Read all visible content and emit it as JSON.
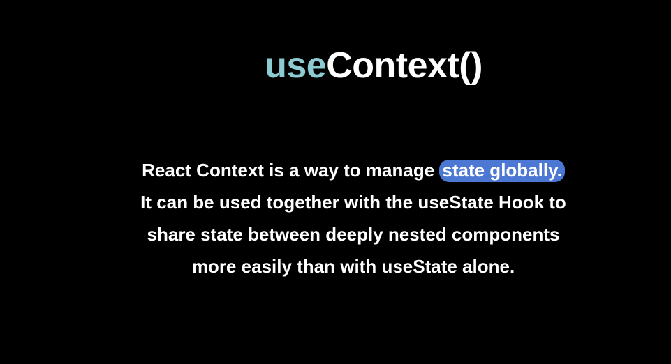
{
  "slide": {
    "title_accent": "use",
    "title_main": "Context()",
    "lines": {
      "line1_before": "React Context is a way to manage ",
      "line1_highlight": "state globally.",
      "line2": "It can be used together with the useState Hook to",
      "line3": "share state between deeply nested components",
      "line4": "more easily than with useState alone."
    }
  },
  "colors": {
    "background": "#000000",
    "accent": "#8ccbd2",
    "text": "#ffffff",
    "highlight": "#4c78d4"
  }
}
